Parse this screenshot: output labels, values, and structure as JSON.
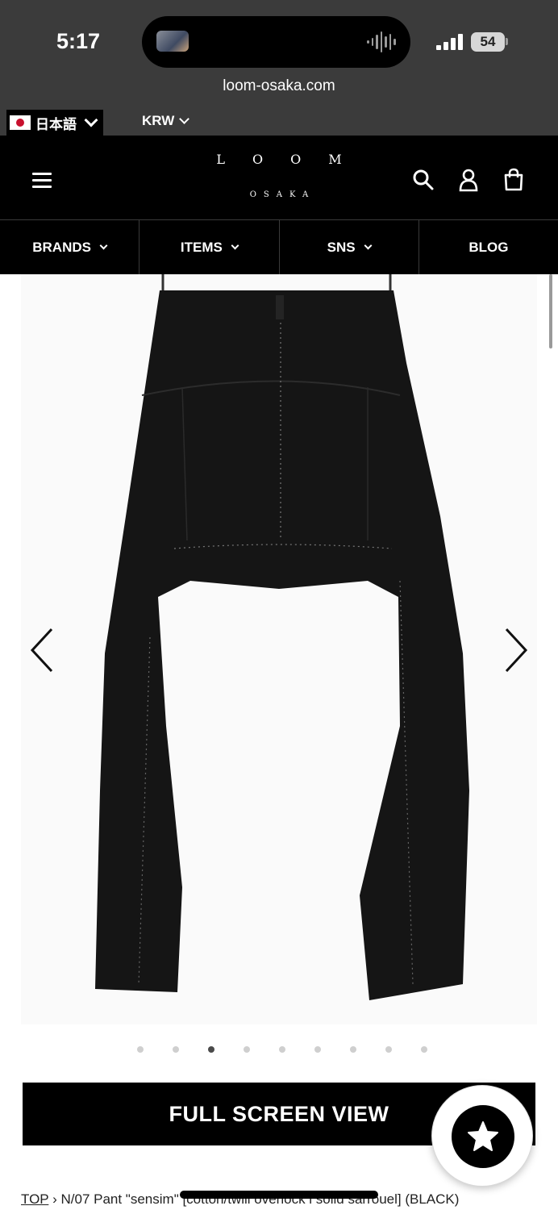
{
  "status_bar": {
    "time": "5:17",
    "battery": "54"
  },
  "browser": {
    "url": "loom-osaka.com"
  },
  "locale": {
    "language": "日本語",
    "currency": "KRW"
  },
  "logo": {
    "main": "LOOM",
    "sub": "OSAKA"
  },
  "nav": [
    {
      "label": "BRANDS",
      "has_dropdown": true
    },
    {
      "label": "ITEMS",
      "has_dropdown": true
    },
    {
      "label": "SNS",
      "has_dropdown": true
    },
    {
      "label": "BLOG",
      "has_dropdown": false
    }
  ],
  "gallery": {
    "slide_count": 9,
    "active_index": 2
  },
  "full_screen_label": "FULL SCREEN VIEW",
  "breadcrumb": {
    "top": "TOP",
    "separator": "›",
    "current": "N/07 Pant \"sensim\" [cotton/twill overlock i solid sarrouel] (BLACK)"
  },
  "colors": {
    "header_bg": "#000000",
    "status_bg": "#3b3b3b",
    "accent": "#c8102e"
  }
}
